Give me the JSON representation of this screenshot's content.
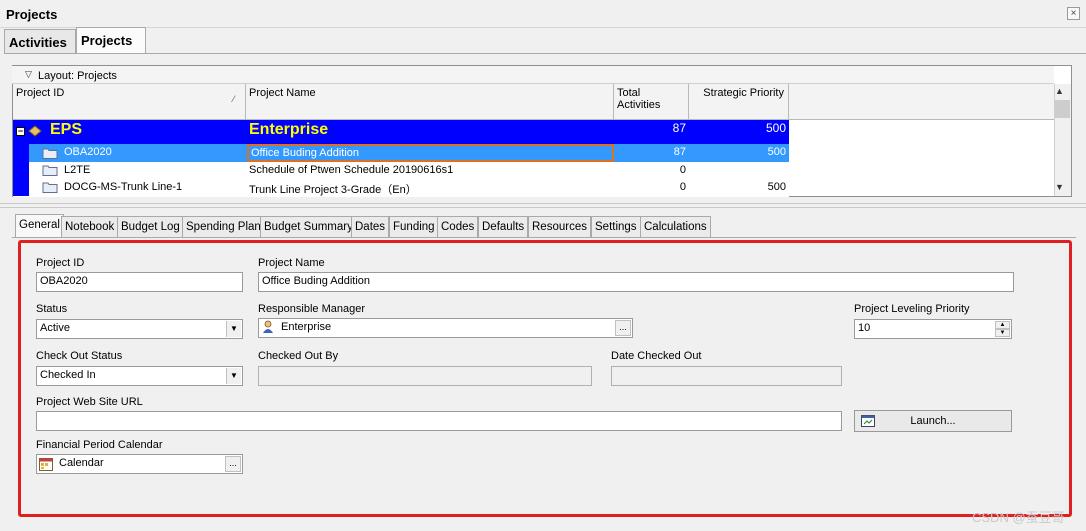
{
  "window": {
    "title": "Projects",
    "close_glyph": "×"
  },
  "top_tabs": [
    {
      "label": "Activities",
      "active": false
    },
    {
      "label": "Projects",
      "active": true
    }
  ],
  "grid": {
    "layout_label": "Layout: Projects",
    "columns": [
      "Project ID",
      "Project Name",
      "Total Activities",
      "Strategic Priority"
    ],
    "rows": [
      {
        "id": "EPS",
        "name": "Enterprise",
        "total": "87",
        "priority": "500",
        "type": "eps"
      },
      {
        "id": "OBA2020",
        "name": "Office Buding Addition",
        "total": "87",
        "priority": "500",
        "type": "project",
        "selected": true
      },
      {
        "id": "L2TE",
        "name": "Schedule of Ptwen Schedule 20190616s1",
        "total": "0",
        "priority": "",
        "type": "project"
      },
      {
        "id": "DOCG-MS-Trunk Line-1",
        "name": "Trunk Line Project 3-Grade（En）",
        "total": "0",
        "priority": "500",
        "type": "project"
      }
    ],
    "colors": {
      "eps_bg": "#0000ff",
      "eps_text": "#ffff00",
      "selected_bg": "#3399ff",
      "edit_border": "#e07020"
    }
  },
  "detail_tabs": [
    "General",
    "Notebook",
    "Budget Log",
    "Spending Plan",
    "Budget Summary",
    "Dates",
    "Funding",
    "Codes",
    "Defaults",
    "Resources",
    "Settings",
    "Calculations"
  ],
  "form": {
    "project_id_label": "Project ID",
    "project_id_value": "OBA2020",
    "project_name_label": "Project Name",
    "project_name_value": "Office Buding Addition",
    "status_label": "Status",
    "status_value": "Active",
    "manager_label": "Responsible Manager",
    "manager_value": "Enterprise",
    "leveling_label": "Project Leveling Priority",
    "leveling_value": "10",
    "checkout_status_label": "Check Out Status",
    "checkout_status_value": "Checked In",
    "checked_out_by_label": "Checked Out By",
    "checked_out_by_value": "",
    "date_checked_out_label": "Date Checked Out",
    "date_checked_out_value": "",
    "url_label": "Project Web Site URL",
    "url_value": "",
    "launch_label": "Launch...",
    "calendar_label": "Financial Period Calendar",
    "calendar_value": "Calendar",
    "browse_glyph": "..."
  },
  "highlight_color": "#e02020",
  "watermark": "CSDN @蚕豆哥"
}
